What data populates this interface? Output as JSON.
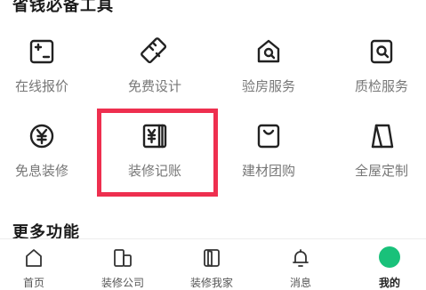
{
  "tools_section": {
    "title": "省钱必备工具",
    "items": [
      {
        "label": "在线报价",
        "icon": "calculator-icon"
      },
      {
        "label": "免费设计",
        "icon": "ruler-pencil-icon"
      },
      {
        "label": "验房服务",
        "icon": "house-search-icon"
      },
      {
        "label": "质检服务",
        "icon": "quality-check-icon"
      },
      {
        "label": "免息装修",
        "icon": "yuan-coin-icon"
      },
      {
        "label": "装修记账",
        "icon": "ledger-icon"
      },
      {
        "label": "建材团购",
        "icon": "shopping-bag-icon"
      },
      {
        "label": "全屋定制",
        "icon": "wardrobe-icon"
      }
    ]
  },
  "more_section": {
    "title": "更多功能"
  },
  "highlight": {
    "target": "装修记账",
    "color": "#ee2f4f"
  },
  "tabbar": {
    "tabs": [
      {
        "label": "首页",
        "icon": "home-icon",
        "active": false
      },
      {
        "label": "装修公司",
        "icon": "company-icon",
        "active": false
      },
      {
        "label": "装修我家",
        "icon": "my-home-icon",
        "active": false
      },
      {
        "label": "消息",
        "icon": "bell-icon",
        "active": false
      },
      {
        "label": "我的",
        "icon": "profile-icon",
        "active": true
      }
    ]
  },
  "colors": {
    "accent": "#19c17a",
    "highlight_border": "#ee2f4f",
    "label_text": "#777777"
  }
}
